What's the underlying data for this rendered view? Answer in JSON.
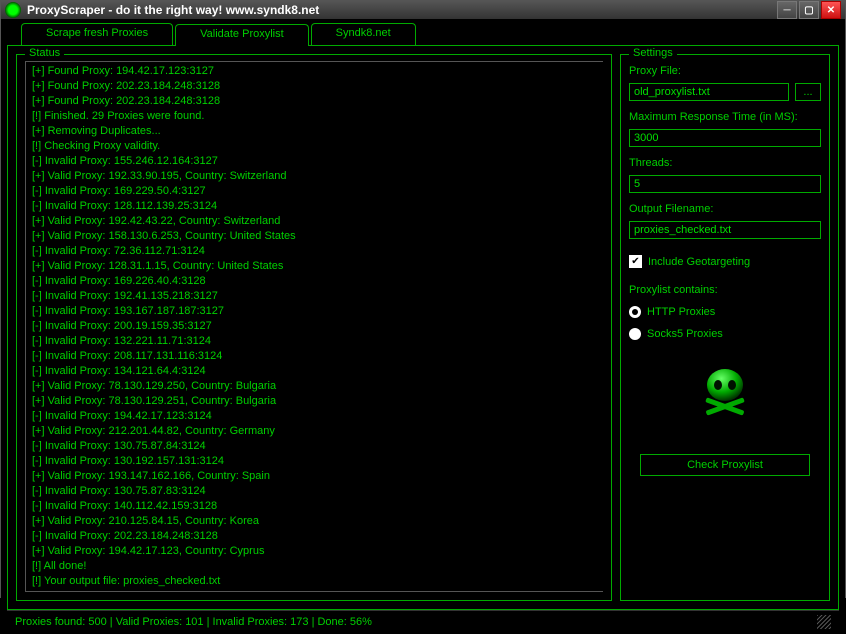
{
  "window": {
    "title": "ProxyScraper - do it the right way! www.syndk8.net"
  },
  "tabs": [
    {
      "label": "Scrape fresh Proxies",
      "active": false
    },
    {
      "label": "Validate Proxylist",
      "active": true
    },
    {
      "label": "Syndk8.net",
      "active": false
    }
  ],
  "status": {
    "legend": "Status",
    "lines": [
      "[+] Found Proxy: 194.42.17.123:3127",
      "[+] Found Proxy: 202.23.184.248:3128",
      "[+] Found Proxy: 202.23.184.248:3128",
      "[!] Finished. 29 Proxies were found.",
      "[+] Removing Duplicates...",
      "[!] Checking Proxy validity.",
      "[-] Invalid Proxy: 155.246.12.164:3127",
      "[+] Valid Proxy: 192.33.90.195, Country: Switzerland",
      "[-] Invalid Proxy: 169.229.50.4:3127",
      "[-] Invalid Proxy: 128.112.139.25:3124",
      "[+] Valid Proxy: 192.42.43.22, Country: Switzerland",
      "[+] Valid Proxy: 158.130.6.253, Country: United States",
      "[-] Invalid Proxy: 72.36.112.71:3124",
      "[+] Valid Proxy: 128.31.1.15, Country: United States",
      "[-] Invalid Proxy: 169.226.40.4:3128",
      "[-] Invalid Proxy: 192.41.135.218:3127",
      "[-] Invalid Proxy: 193.167.187.187:3127",
      "[-] Invalid Proxy: 200.19.159.35:3127",
      "[-] Invalid Proxy: 132.221.11.71:3124",
      "[-] Invalid Proxy: 208.117.131.116:3124",
      "[-] Invalid Proxy: 134.121.64.4:3124",
      "[+] Valid Proxy: 78.130.129.250, Country: Bulgaria",
      "[+] Valid Proxy: 78.130.129.251, Country: Bulgaria",
      "[-] Invalid Proxy: 194.42.17.123:3124",
      "[+] Valid Proxy: 212.201.44.82, Country: Germany",
      "[-] Invalid Proxy: 130.75.87.84:3124",
      "[-] Invalid Proxy: 130.192.157.131:3124",
      "[+] Valid Proxy: 193.147.162.166, Country: Spain",
      "[-] Invalid Proxy: 130.75.87.83:3124",
      "[-] Invalid Proxy: 140.112.42.159:3128",
      "[+] Valid Proxy: 210.125.84.15, Country: Korea",
      "[-] Invalid Proxy: 202.23.184.248:3128",
      "[+] Valid Proxy: 194.42.17.123, Country: Cyprus",
      "[!] All done!",
      "[!] Your output file: proxies_checked.txt"
    ]
  },
  "settings": {
    "legend": "Settings",
    "proxy_file_label": "Proxy File:",
    "proxy_file_value": "old_proxylist.txt",
    "browse_label": "...",
    "max_response_label": "Maximum Response Time (in MS):",
    "max_response_value": "3000",
    "threads_label": "Threads:",
    "threads_value": "5",
    "output_label": "Output Filename:",
    "output_value": "proxies_checked.txt",
    "geo_label": "Include Geotargeting",
    "geo_checked": true,
    "contains_label": "Proxylist contains:",
    "radio_http": "HTTP Proxies",
    "radio_socks": "Socks5 Proxies",
    "radio_selected": "http",
    "check_button": "Check Proxylist"
  },
  "statusbar": {
    "text": "Proxies found: 500 | Valid Proxies: 101 | Invalid Proxies: 173 | Done: 56%"
  }
}
